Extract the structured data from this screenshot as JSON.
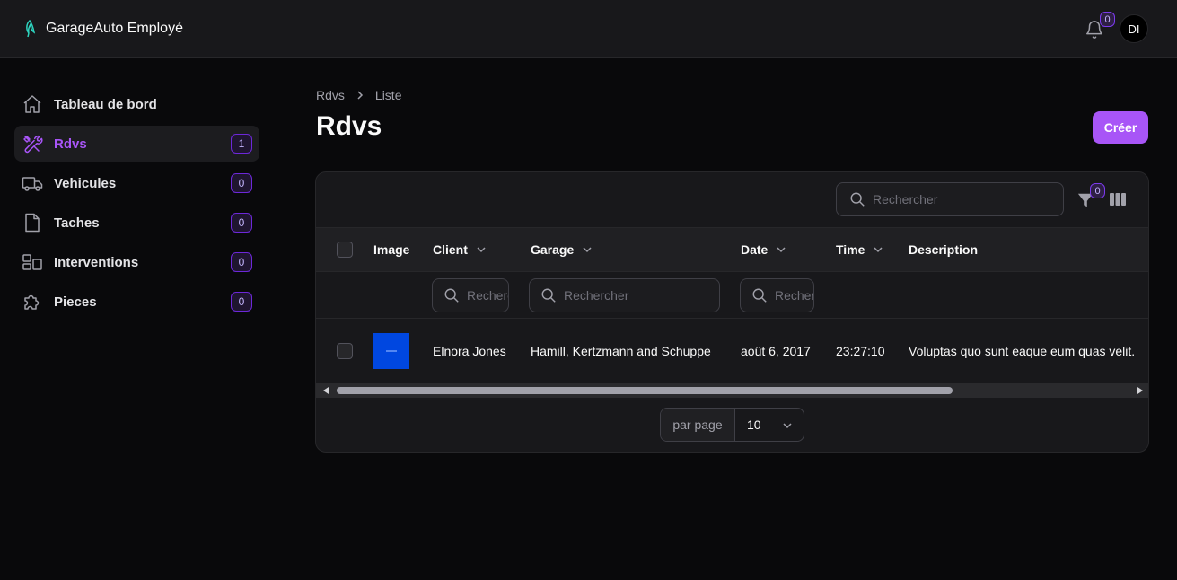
{
  "app": {
    "title": "GarageAuto Employé"
  },
  "header": {
    "notifications_count": "0",
    "avatar_initials": "DI"
  },
  "sidebar": {
    "items": [
      {
        "label": "Tableau de bord",
        "icon": "home-icon"
      },
      {
        "label": "Rdvs",
        "icon": "tools-icon",
        "badge": "1",
        "active": true
      },
      {
        "label": "Vehicules",
        "icon": "truck-icon",
        "badge": "0"
      },
      {
        "label": "Taches",
        "icon": "document-icon",
        "badge": "0"
      },
      {
        "label": "Interventions",
        "icon": "layout-icon",
        "badge": "0"
      },
      {
        "label": "Pieces",
        "icon": "puzzle-icon",
        "badge": "0"
      }
    ]
  },
  "breadcrumb": {
    "parent": "Rdvs",
    "current": "Liste"
  },
  "page": {
    "title": "Rdvs",
    "create_label": "Créer"
  },
  "table": {
    "search_placeholder": "Rechercher",
    "filter_count": "0",
    "columns": [
      "Image",
      "Client",
      "Garage",
      "Date",
      "Time",
      "Description"
    ],
    "column_search": {
      "client_placeholder": "Rechercher",
      "garage_placeholder": "Rechercher",
      "date_placeholder": "Rechercher"
    },
    "rows": [
      {
        "client": "Elnora Jones",
        "garage": "Hamill, Kertzmann and Schuppe",
        "date": "août 6, 2017",
        "time": "23:27:10",
        "description": "Voluptas quo sunt eaque eum quas velit."
      }
    ]
  },
  "pagination": {
    "per_page_label": "par page",
    "per_page_value": "10"
  },
  "colors": {
    "accent": "#a855f7",
    "background": "#09090b",
    "surface": "#18181b",
    "thumbnail": "#0047e0"
  }
}
